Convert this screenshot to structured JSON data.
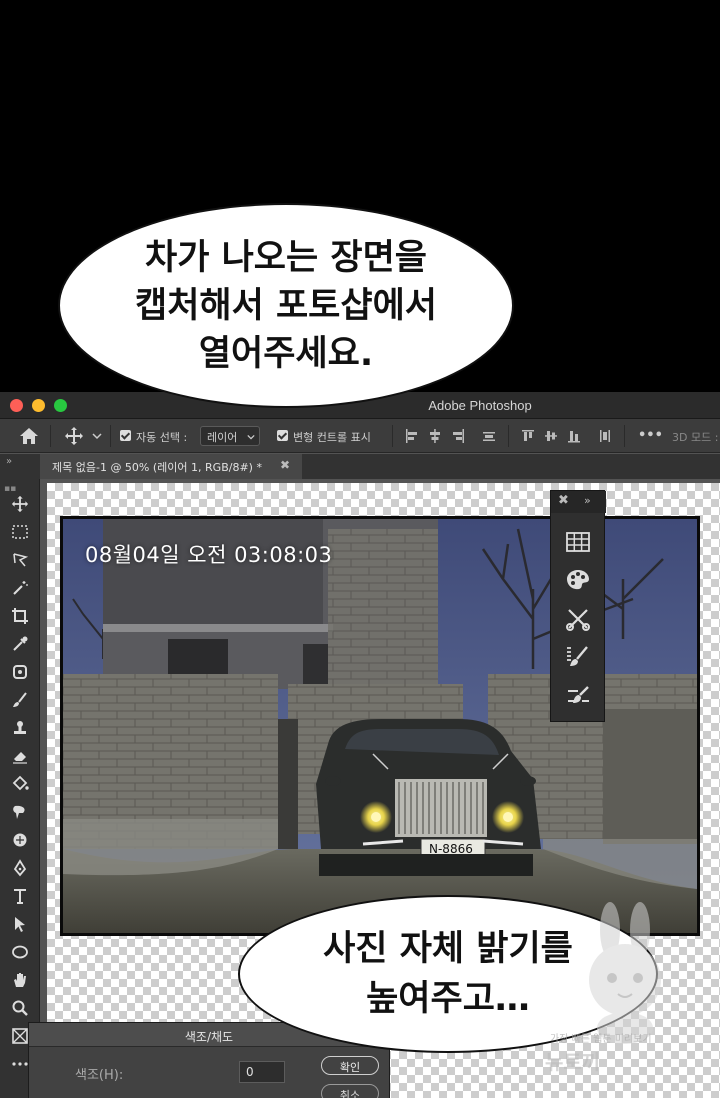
{
  "speech_top": {
    "lines": [
      "차가 나오는 장면을",
      "캡처해서 포토샵에서",
      "열어주세요."
    ]
  },
  "speech_bottom": {
    "lines": [
      "사진 자체 밝기를",
      "높여주고…"
    ]
  },
  "window": {
    "title": "Adobe Photoshop"
  },
  "options_bar": {
    "auto_select_label": "자동 선택 :",
    "auto_select_value": "레이어",
    "transform_label": "변형 컨트롤 표시",
    "more": "•••",
    "mode_3d": "3D 모드 :"
  },
  "document_tab": {
    "label": "제목 없음-1 @ 50% (레이어 1, RGB/8#) *",
    "close": "✖"
  },
  "panel_toggle": "»",
  "photo": {
    "timestamp": "08월04일 오전 03:08:03",
    "license_plate": "N-8866"
  },
  "floating_panel": {
    "close": "✖",
    "expand": "»"
  },
  "hue_saturation": {
    "title": "색조/채도",
    "hue_label": "색조(H):",
    "hue_value": "0",
    "ok_label": "확인",
    "cancel_label": "취소"
  },
  "watermark": {
    "line1": "가장 빠른 웹툰 미리보기",
    "line2": "뉴토끼"
  },
  "colors": {
    "accent": "#28c840",
    "panel_bg": "#323232",
    "titlebar_bg": "#2b2b2b",
    "canvas_bg": "#535353"
  }
}
